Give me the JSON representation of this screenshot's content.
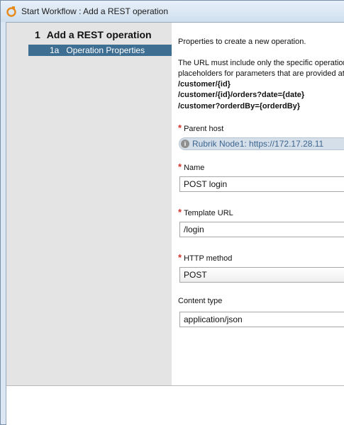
{
  "window": {
    "title": "Start Workflow : Add a REST operation"
  },
  "sidebar": {
    "step": {
      "number": "1",
      "label": "Add a REST operation"
    },
    "substep": {
      "number": "1a",
      "label": "Operation Properties"
    }
  },
  "content": {
    "intro": "Properties to create a new operation.",
    "url_note_line1": "The URL must include only the specific operation",
    "url_note_line2": "placeholders for parameters that are provided at",
    "examples": [
      "/customer/{id}",
      "/customer/{id}/orders?date={date}",
      "/customer?orderdBy={orderdBy}"
    ],
    "fields": {
      "parent_host": {
        "label": "Parent host",
        "required": true,
        "value": "Rubrik Node1: https://172.17.28.11"
      },
      "name": {
        "label": "Name",
        "required": true,
        "value": "POST login"
      },
      "template_url": {
        "label": "Template URL",
        "required": true,
        "value": "/login"
      },
      "http_method": {
        "label": "HTTP method",
        "required": true,
        "value": "POST"
      },
      "content_type": {
        "label": "Content type",
        "required": false,
        "value": "application/json"
      }
    },
    "required_marker": "*"
  },
  "icons": {
    "app": "orchestrator-logo-icon",
    "info": "info-icon"
  },
  "colors": {
    "substep_bg": "#3f6e93",
    "required": "#d0342c",
    "parent_host_text": "#3d6690"
  }
}
